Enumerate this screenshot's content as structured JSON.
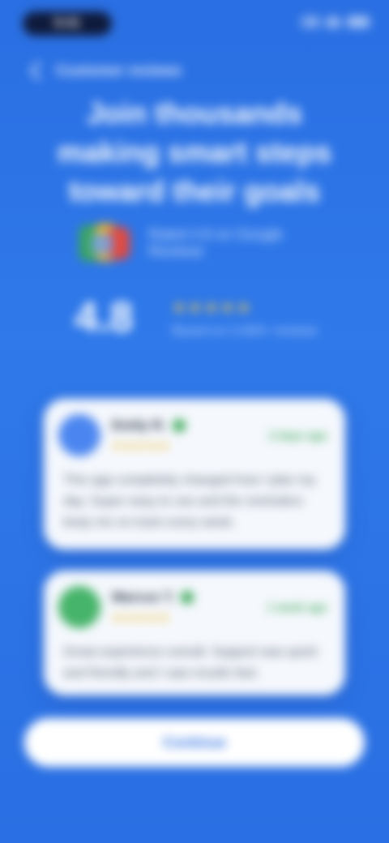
{
  "status_bar": {
    "time": "9:41"
  },
  "top_bar": {
    "title": "Customer reviews"
  },
  "headline": "Join thousands making smart steps toward their goals",
  "google_rating": {
    "label": "Rated 4.8 on Google Reviews"
  },
  "summary": {
    "score": "4.8",
    "stars": "★★★★★",
    "count": "Based on 2,000+ reviews"
  },
  "reviews": [
    {
      "name": "Emily R.",
      "stars": "★★★★★",
      "date": "2 days ago",
      "text": "This app completely changed how I plan my day. Super easy to use and the reminders keep me on track every week."
    },
    {
      "name": "Marcus T.",
      "stars": "★★★★★",
      "date": "1 week ago",
      "text": "Great experience overall. Support was quick and friendly and I saw results fast."
    }
  ],
  "cta": {
    "label": "Continue"
  },
  "colors": {
    "background": "#2a6fe3",
    "card": "#f5f8fd",
    "accent_green": "#3aa757",
    "star_yellow": "#f1b823"
  },
  "icons": {
    "back": "back-arrow-icon",
    "verified": "verified-badge-icon",
    "signal": "signal-icon",
    "wifi": "wifi-icon",
    "battery": "battery-icon"
  }
}
